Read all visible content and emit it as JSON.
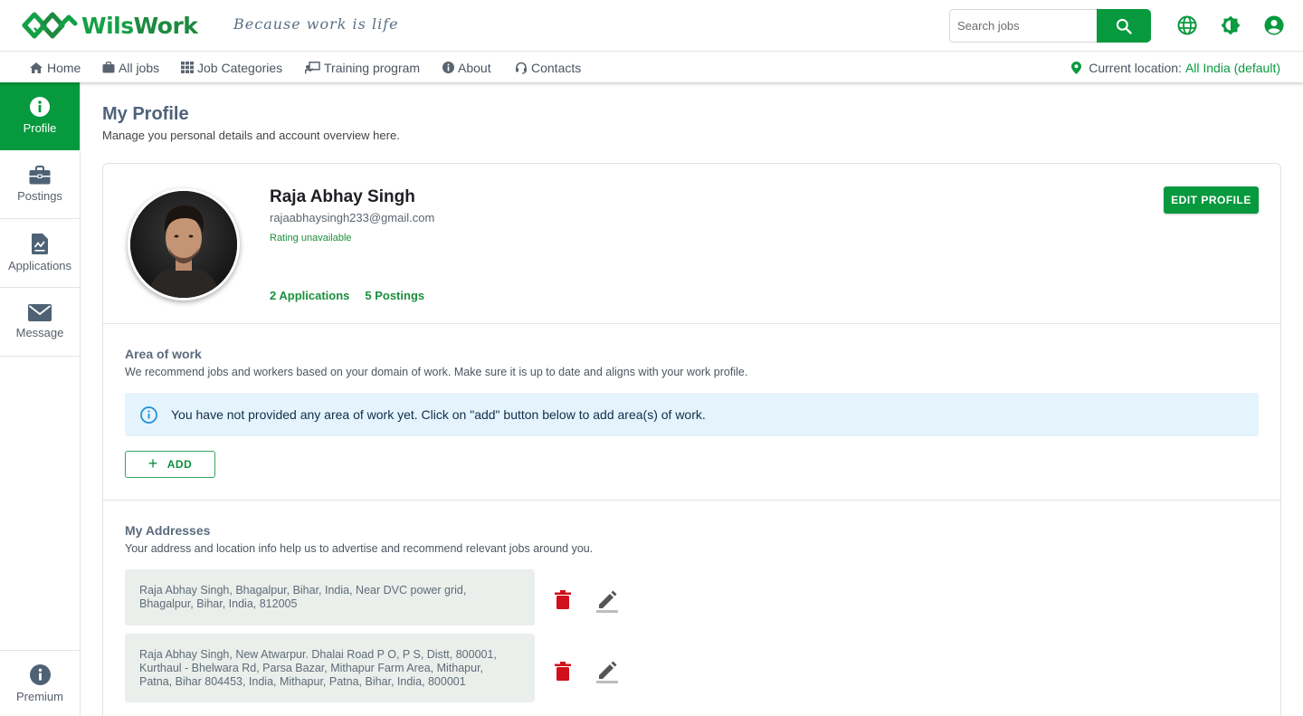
{
  "brand": {
    "name_part1": "Wils",
    "name_part2": "Work",
    "tagline": "Because work is life"
  },
  "header": {
    "search_placeholder": "Search jobs",
    "icons": [
      "search-icon",
      "globe-icon",
      "brightness-icon",
      "account-icon"
    ]
  },
  "nav": {
    "items": [
      {
        "label": "Home",
        "icon": "home-icon"
      },
      {
        "label": "All jobs",
        "icon": "briefcase-icon"
      },
      {
        "label": "Job Categories",
        "icon": "grid-icon"
      },
      {
        "label": "Training program",
        "icon": "presentation-icon"
      },
      {
        "label": "About",
        "icon": "info-icon"
      },
      {
        "label": "Contacts",
        "icon": "headset-icon"
      }
    ],
    "location_label": "Current location:",
    "location_value": "All India (default)"
  },
  "sidebar": {
    "items": [
      {
        "label": "Profile",
        "icon": "info-icon",
        "active": true
      },
      {
        "label": "Postings",
        "icon": "briefcase-icon"
      },
      {
        "label": "Applications",
        "icon": "document-chart-icon"
      },
      {
        "label": "Message",
        "icon": "mail-icon"
      }
    ],
    "premium_label": "Premium"
  },
  "page": {
    "title": "My Profile",
    "subtitle": "Manage you personal details and account overview here."
  },
  "profile": {
    "name": "Raja Abhay Singh",
    "email": "rajaabhaysingh233@gmail.com",
    "rating": "Rating unavailable",
    "applications": "2 Applications",
    "postings": "5 Postings",
    "edit_label": "EDIT PROFILE"
  },
  "area_of_work": {
    "title": "Area of work",
    "subtitle": "We recommend jobs and workers based on your domain of work. Make sure it is up to date and aligns with your work profile.",
    "info": "You have not provided any area of work yet. Click on \"add\" button below to add area(s) of work.",
    "add_label": "ADD"
  },
  "addresses": {
    "title": "My Addresses",
    "subtitle": "Your address and location info help us to advertise and recommend relevant jobs around you.",
    "items": [
      {
        "line1": "Raja Abhay Singh, Bhagalpur, Bihar, India, Near DVC power grid,",
        "line2": "Bhagalpur, Bihar, India, 812005",
        "line3": ""
      },
      {
        "line1": "Raja Abhay Singh, New Atwarpur. Dhalai Road P O, P S, Distt, 800001,",
        "line2": "Kurthaul - Bhelwara Rd, Parsa Bazar, Mithapur Farm Area, Mithapur,",
        "line3": "Patna, Bihar 804453, India, Mithapur, Patna, Bihar, India, 800001"
      }
    ]
  },
  "colors": {
    "primary": "#06993d",
    "info_bg": "#e5f3fd",
    "delete": "#d0101b"
  }
}
